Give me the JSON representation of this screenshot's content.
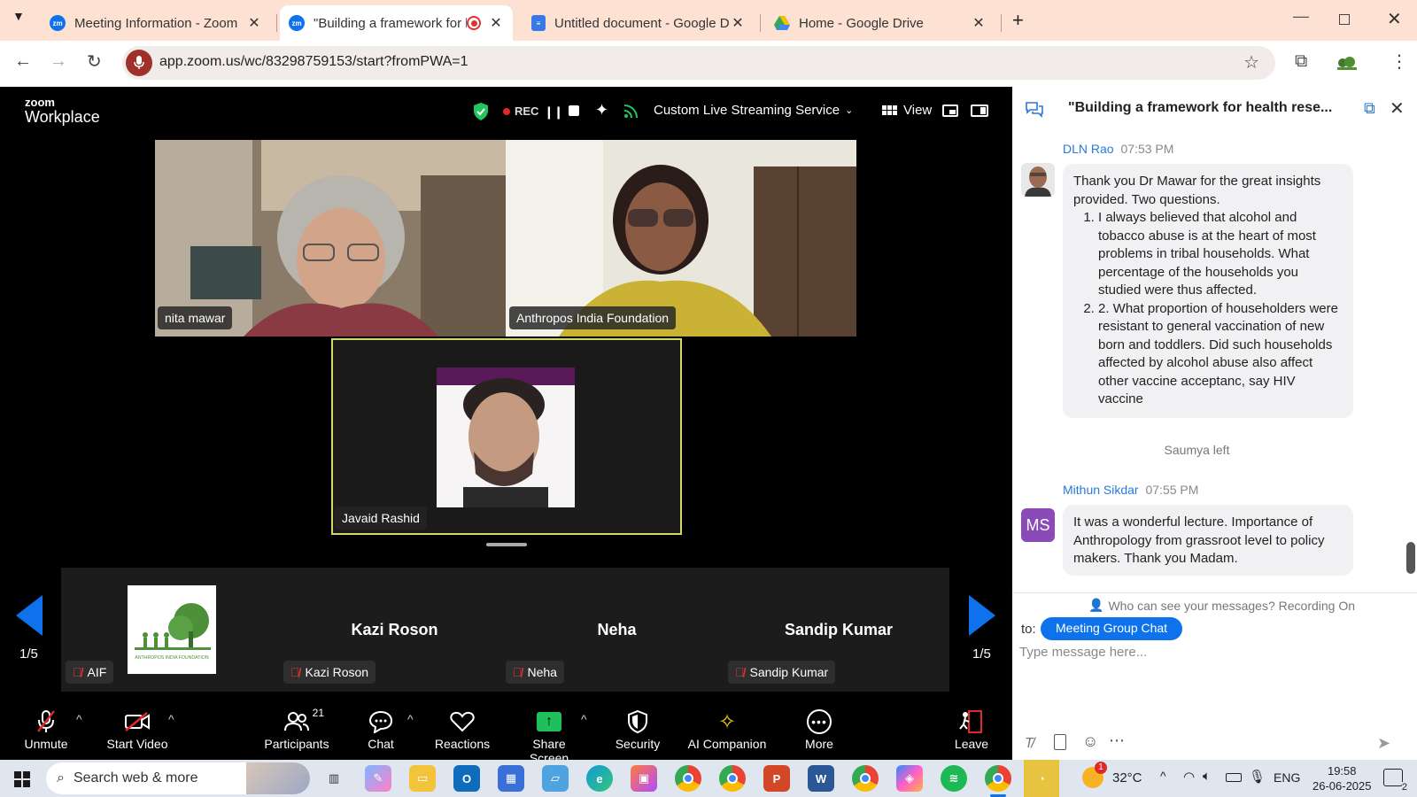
{
  "browser": {
    "tabs": [
      {
        "title": "Meeting Information - Zoom",
        "favicon": "zoom-icon"
      },
      {
        "title": "\"Building a framework for h",
        "favicon": "zoom-icon",
        "recording": true
      },
      {
        "title": "Untitled document - Google Dc",
        "favicon": "google-docs-icon"
      },
      {
        "title": "Home - Google Drive",
        "favicon": "google-drive-icon"
      }
    ],
    "url": "app.zoom.us/wc/83298759153/start?fromPWA=1"
  },
  "zoom_header": {
    "logo_line1": "zoom",
    "logo_line2": "Workplace",
    "rec_label": "REC",
    "streaming_label": "Custom Live Streaming Service",
    "view_label": "View"
  },
  "videos": {
    "tile1_name": "nita mawar",
    "tile2_name": "Anthropos India Foundation",
    "tile3_name": "Javaid Rashid"
  },
  "gallery": {
    "page_left": "1/5",
    "page_right": "1/5",
    "participants": [
      {
        "display": "",
        "tag": "AIF",
        "logo_text": "ANTHROPOS INDIA FOUNDATION"
      },
      {
        "display": "Kazi Roson",
        "tag": "Kazi Roson"
      },
      {
        "display": "Neha",
        "tag": "Neha"
      },
      {
        "display": "Sandip Kumar",
        "tag": "Sandip Kumar"
      }
    ]
  },
  "toolbar": {
    "unmute": "Unmute",
    "start_video": "Start Video",
    "participants": "Participants",
    "participants_count": "21",
    "chat": "Chat",
    "reactions": "Reactions",
    "share_screen": "Share Screen",
    "security": "Security",
    "ai_companion": "AI Companion",
    "more": "More",
    "leave": "Leave"
  },
  "chat": {
    "title": "\"Building a framework for health rese...",
    "messages": [
      {
        "sender": "DLN Rao",
        "time": "07:53 PM",
        "intro": "Thank you Dr Mawar for the great insights provided. Two questions.",
        "items": [
          "I always believed that alcohol and tobacco abuse is at the heart of most problems in tribal households. What percentage of the households you studied were thus affected.",
          "2. What proportion of householders were resistant to general vaccination of new born and toddlers. Did such households affected by alcohol abuse also affect other vaccine acceptanc, say HIV vaccine"
        ]
      },
      {
        "sender": "Mithun Sikdar",
        "time": "07:55 PM",
        "avatar_initials": "MS",
        "text": "It was a wonderful lecture. Importance of Anthropology from grassroot level to policy makers. Thank you Madam."
      }
    ],
    "system_message": "Saumya left",
    "visibility_note": "Who can see your messages? Recording On",
    "to_label": "to:",
    "recipient": "Meeting Group Chat",
    "input_placeholder": "Type message here..."
  },
  "taskbar": {
    "search_placeholder": "Search web & more",
    "weather": "32°C",
    "weather_badge": "1",
    "language": "ENG",
    "time": "19:58",
    "date": "26-06-2025",
    "notification_count": "2"
  },
  "colors": {
    "tabstrip_bg": "#fde2d3",
    "zoom_blue": "#0e72ed",
    "rec_red": "#e02828",
    "security_green": "#22c55e",
    "share_green": "#1fbf5b",
    "active_speaker_border": "#d4d86a",
    "chat_sender_blue": "#2a79d6",
    "ms_avatar": "#8a4bb8"
  }
}
